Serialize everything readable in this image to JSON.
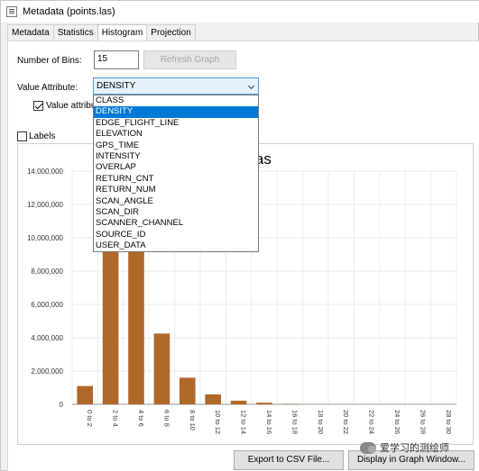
{
  "window": {
    "title": "Metadata (points.las)"
  },
  "tabs": [
    {
      "label": "Metadata"
    },
    {
      "label": "Statistics"
    },
    {
      "label": "Histogram"
    },
    {
      "label": "Projection"
    }
  ],
  "controls": {
    "bins_label": "Number of Bins:",
    "bins_value": "15",
    "refresh_label": "Refresh Graph",
    "value_attr_label": "Value Attribute:",
    "value_attr_selected": "DENSITY",
    "value_attr_checkbox_label": "Value attribu",
    "labels_checkbox_label": "Labels"
  },
  "dropdown": {
    "options": [
      "CLASS",
      "DENSITY",
      "EDGE_FLIGHT_LINE",
      "ELEVATION",
      "GPS_TIME",
      "INTENSITY",
      "OVERLAP",
      "RETURN_CNT",
      "RETURN_NUM",
      "SCAN_ANGLE",
      "SCAN_DIR",
      "SCANNER_CHANNEL",
      "SOURCE_ID",
      "USER_DATA"
    ],
    "selected_index": 1
  },
  "buttons": {
    "export": "Export to CSV File...",
    "display": "Display in Graph Window..."
  },
  "watermark": {
    "text": "爱学习的测绘师"
  },
  "colors": {
    "bar": "#b0682a",
    "selection": "#0078d7",
    "select_border": "#569de5"
  },
  "chart_data": {
    "type": "bar",
    "title": "las",
    "categories": [
      "0 to 2",
      "2 to 4",
      "4 to 6",
      "6 to 8",
      "8 to 10",
      "10 to 12",
      "12 to 14",
      "14 to 16",
      "16 to 18",
      "18 to 20",
      "20 to 22",
      "22 to 24",
      "24 to 26",
      "26 to 28",
      "28 to 30"
    ],
    "values": [
      1100000,
      9600000,
      10300000,
      4250000,
      1600000,
      600000,
      220000,
      100000,
      30000,
      0,
      0,
      0,
      0,
      0,
      0
    ],
    "yticks": [
      "0",
      "2,000,000",
      "4,000,000",
      "6,000,000",
      "8,000,000",
      "10,000,000",
      "12,000,000",
      "14,000,000"
    ],
    "ylim": [
      0,
      14000000
    ],
    "grid": true
  }
}
